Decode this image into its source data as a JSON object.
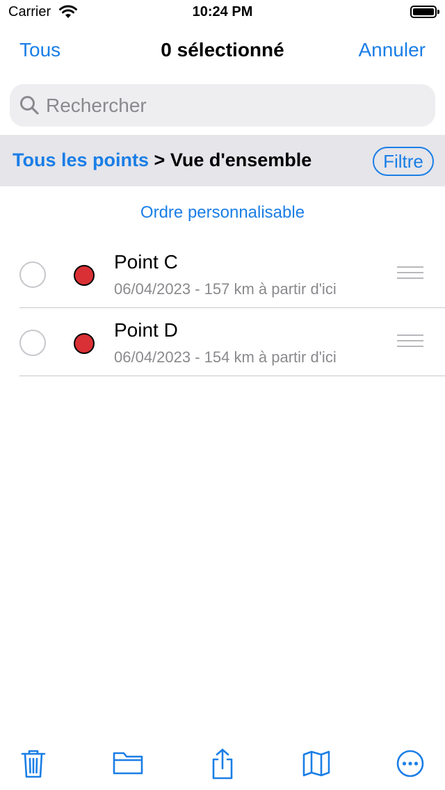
{
  "status_bar": {
    "carrier": "Carrier",
    "time": "10:24 PM"
  },
  "nav": {
    "left_label": "Tous",
    "title": "0 sélectionné",
    "right_label": "Annuler"
  },
  "search": {
    "placeholder": "Rechercher"
  },
  "breadcrumb": {
    "link": "Tous les points",
    "separator": ">",
    "current": "Vue d'ensemble",
    "filter_label": "Filtre"
  },
  "sort_label": "Ordre personnalisable",
  "points": [
    {
      "title": "Point C",
      "subtitle": "06/04/2023 - 157 km à partir d'ici",
      "color": "#d93035"
    },
    {
      "title": "Point D",
      "subtitle": "06/04/2023 - 154 km à partir d'ici",
      "color": "#d93035"
    }
  ],
  "toolbar": {
    "icons": [
      "trash-icon",
      "folder-icon",
      "share-icon",
      "map-icon",
      "more-icon"
    ]
  },
  "colors": {
    "accent": "#1a7ee6",
    "point_red": "#d93035",
    "secondary_text": "#8a8a8e",
    "breadcrumb_bg": "#e5e5ea"
  }
}
